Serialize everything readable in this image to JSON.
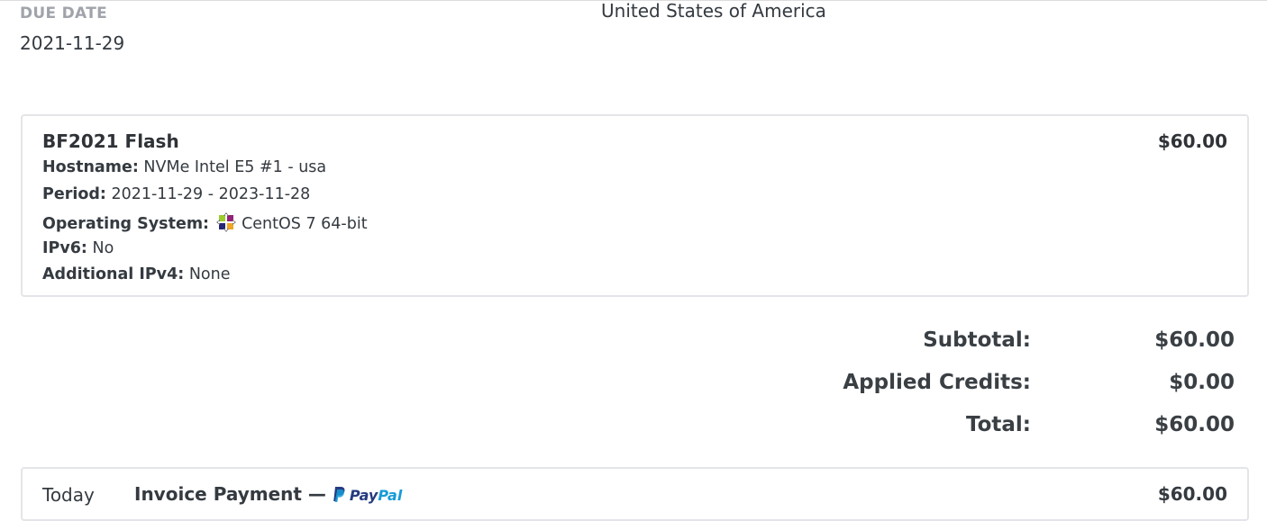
{
  "due": {
    "label": "DUE DATE",
    "value": "2021-11-29"
  },
  "address": {
    "country": "United States of America"
  },
  "item": {
    "title": "BF2021 Flash",
    "price": "$60.00",
    "hostname_label": "Hostname:",
    "hostname": "NVMe Intel E5 #1 - usa",
    "period_label": "Period:",
    "period": "2021-11-29 - 2023-11-28",
    "os_label": "Operating System:",
    "os_icon": "centos-logo-icon",
    "os": "CentOS 7 64-bit",
    "ipv6_label": "IPv6:",
    "ipv6": "No",
    "ipv4_label": "Additional IPv4:",
    "ipv4": "None"
  },
  "totals": {
    "subtotal_label": "Subtotal:",
    "subtotal": "$60.00",
    "credits_label": "Applied Credits:",
    "credits": "$0.00",
    "total_label": "Total:",
    "total": "$60.00"
  },
  "payment": {
    "date": "Today",
    "description": "Invoice Payment —",
    "method_icon": "paypal-logo-icon",
    "method_a": "Pay",
    "method_b": "Pal",
    "amount": "$60.00"
  },
  "colors": {
    "text": "#343a40",
    "muted": "#a0a4aa",
    "border": "#e3e5e8",
    "paypal_dark": "#253b80",
    "paypal_light": "#179bd7"
  }
}
